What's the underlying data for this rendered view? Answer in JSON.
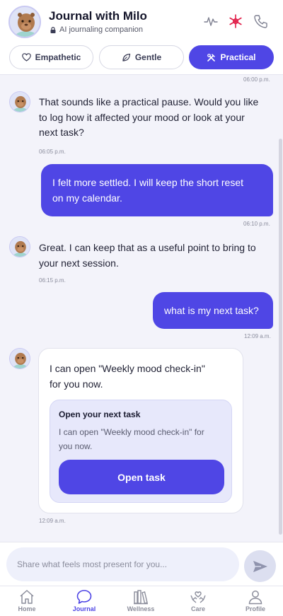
{
  "header": {
    "title": "Journal with Milo",
    "subtitle": "AI journaling companion",
    "icons": [
      "activity-icon",
      "asterisk-icon",
      "phone-icon"
    ],
    "accent_color": "#e11d48"
  },
  "modes": [
    {
      "label": "Empathetic",
      "icon": "heart-icon",
      "active": false
    },
    {
      "label": "Gentle",
      "icon": "leaf-icon",
      "active": false
    },
    {
      "label": "Practical",
      "icon": "tools-icon",
      "active": true
    }
  ],
  "chat": {
    "top_timestamp": "06:00 p.m.",
    "messages": [
      {
        "sender": "bot",
        "lines": [
          "That sounds like a practical pause. Would you like",
          "to log how it affected your mood or look at your",
          "next task?"
        ],
        "time": "06:05 p.m."
      },
      {
        "sender": "user",
        "lines": [
          "I felt more settled. I will keep the short reset",
          "on my calendar."
        ],
        "time": "06:10 p.m."
      },
      {
        "sender": "bot",
        "lines": [
          "Great. I can keep that as a useful point to bring to",
          "your next session."
        ],
        "time": "06:15 p.m."
      },
      {
        "sender": "user",
        "lines": [
          "what is my next task?"
        ],
        "time": "12:09 a.m."
      },
      {
        "sender": "bot",
        "lines": [
          "I can open \"Weekly mood check-in\"",
          "for you now."
        ],
        "time": "12:09 a.m."
      }
    ],
    "task_card": {
      "title": "Open your next task",
      "desc_lines": [
        "I can open \"Weekly mood check-in\" for",
        "you now."
      ],
      "button_label": "Open task"
    }
  },
  "composer": {
    "placeholder": "Share what feels most present for you..."
  },
  "tabs": [
    {
      "label": "Home",
      "icon": "home-icon",
      "active": false
    },
    {
      "label": "Journal",
      "icon": "chat-bubble-icon",
      "active": true
    },
    {
      "label": "Wellness",
      "icon": "books-icon",
      "active": false
    },
    {
      "label": "Care",
      "icon": "hands-heart-icon",
      "active": false
    },
    {
      "label": "Profile",
      "icon": "person-icon",
      "active": false
    }
  ],
  "colors": {
    "primary": "#4f46e5",
    "background": "#f3f3fa"
  }
}
